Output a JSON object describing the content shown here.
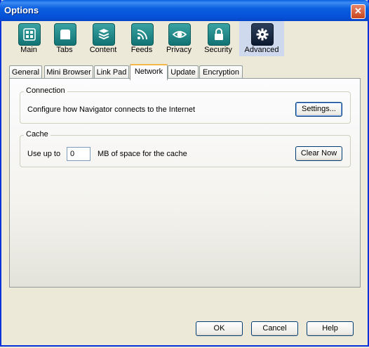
{
  "window": {
    "title": "Options",
    "close_symbol": "✕"
  },
  "toolbar": {
    "items": [
      {
        "label": "Main",
        "icon": "grid-icon"
      },
      {
        "label": "Tabs",
        "icon": "tabs-icon"
      },
      {
        "label": "Content",
        "icon": "content-icon"
      },
      {
        "label": "Feeds",
        "icon": "feed-icon"
      },
      {
        "label": "Privacy",
        "icon": "eye-icon"
      },
      {
        "label": "Security",
        "icon": "lock-icon"
      },
      {
        "label": "Advanced",
        "icon": "gear-icon"
      }
    ],
    "selected": "Advanced"
  },
  "tabs": {
    "items": [
      "General",
      "Mini Browser",
      "Link Pad",
      "Network",
      "Update",
      "Encryption"
    ],
    "selected": "Network"
  },
  "connection": {
    "group_title": "Connection",
    "description": "Configure how Navigator connects to the Internet",
    "settings_button": "Settings..."
  },
  "cache": {
    "group_title": "Cache",
    "prefix": "Use up to",
    "value": "0",
    "suffix": "MB of space for the cache",
    "clear_button": "Clear Now"
  },
  "footer": {
    "ok": "OK",
    "cancel": "Cancel",
    "help": "Help"
  }
}
